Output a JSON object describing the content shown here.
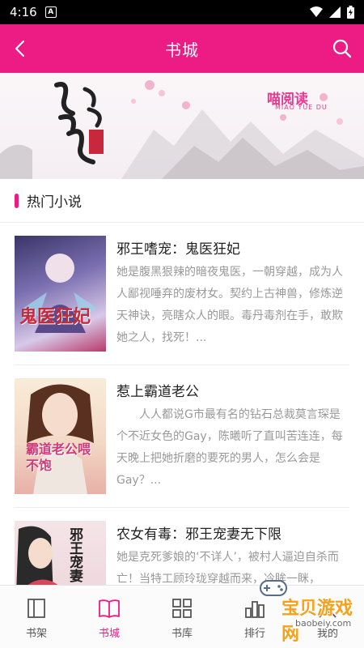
{
  "status_bar": {
    "time": "4:16",
    "notification_icon": "A"
  },
  "header": {
    "title": "书城",
    "back_icon": "chevron-left-icon",
    "search_icon": "search-icon"
  },
  "banner": {
    "title_art": "娘娘初起 胭脂火",
    "logo": "喵阅读",
    "logo_sub": "MIAO YUE DU"
  },
  "section": {
    "label": "热门小说"
  },
  "books": [
    {
      "name": "邪王嗜宠：鬼医狂妃",
      "desc": "她是腹黑狠辣的暗夜鬼医，一朝穿越，成为人人鄙视唾弃的废材女。契约上古神兽，修炼逆天神诀，亮瞎众人的眼。毒丹毒剂在手，敢欺她之人，找死！...",
      "cover_text": "鬼医狂妃"
    },
    {
      "name": "惹上霸道老公",
      "desc": "人人都说G市最有名的钻石总裁莫言琛是个不近女色的Gay，陈曦听了直叫苦连连，每天晚上把她折磨的要死的男人，怎么会是Gay？...",
      "cover_text": "霸道老公喂不饱"
    },
    {
      "name": "农女有毒：邪王宠妻无下限",
      "desc": "她是克死爹娘的‘不详人’，被村人逼迫自杀而亡！当特工顾玲珑穿越而来，冷眸一眯，",
      "cover_text": "邪王宠妻"
    }
  ],
  "tabs": [
    {
      "label": "书架",
      "icon": "bookshelf-icon",
      "active": false
    },
    {
      "label": "书城",
      "icon": "open-book-icon",
      "active": true
    },
    {
      "label": "书库",
      "icon": "grid-icon",
      "active": false
    },
    {
      "label": "排行",
      "icon": "ranking-icon",
      "active": false
    },
    {
      "label": "我的",
      "icon": "profile-icon",
      "active": false
    }
  ],
  "watermark": {
    "text": "宝贝游戏网",
    "url": "baobeiy.com"
  },
  "colors": {
    "accent": "#ec1c84",
    "text_primary": "#222222",
    "text_secondary": "#999999"
  }
}
